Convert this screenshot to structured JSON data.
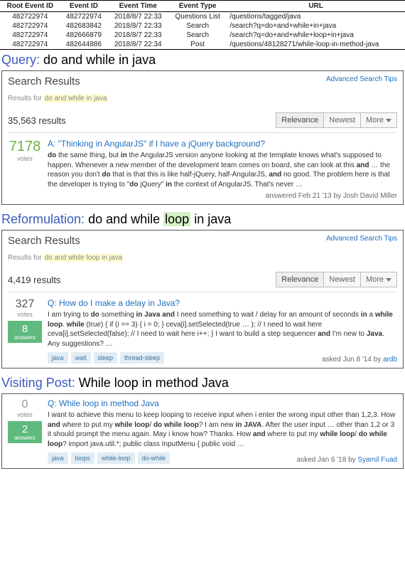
{
  "events": {
    "headers": [
      "Root Event ID",
      "Event ID",
      "Event Time",
      "Event Type",
      "URL"
    ],
    "rows": [
      {
        "root": "482722974",
        "id": "482722974",
        "time": "2018/8/7 22:33",
        "type": "Questions List",
        "url": "/questions/tagged/java"
      },
      {
        "root": "482722974",
        "id": "482683842",
        "time": "2018/8/7 22:33",
        "type": "Search",
        "url": "/search?q=do+and+while+in+java"
      },
      {
        "root": "482722974",
        "id": "482666879",
        "time": "2018/8/7 22:33",
        "type": "Search",
        "url": "/search?q=do+and+while+loop+in+java"
      },
      {
        "root": "482722974",
        "id": "482644886",
        "time": "2018/8/7 22:34",
        "type": "Post",
        "url": "/questions/48128271/while-loop-in-method-java"
      }
    ]
  },
  "sections": {
    "query": {
      "kind": "Query:",
      "text": "do and while in java"
    },
    "reformulation": {
      "kind": "Reformulation:",
      "prefix": "do and while ",
      "diff": "loop",
      "suffix": " in java"
    },
    "visiting": {
      "kind": "Visiting Post:",
      "text": "While loop in method Java"
    }
  },
  "panel1": {
    "title": "Search Results",
    "adv": "Advanced Search Tips",
    "results_for_prefix": "Results for ",
    "results_for_q": "do and while in java",
    "count": "35,563 results",
    "sort": {
      "relevance": "Relevance",
      "newest": "Newest",
      "more": "More"
    },
    "result": {
      "votes": "7178",
      "votes_label": "votes",
      "title": "A: \"Thinking in AngularJS\" if I have a jQuery background?",
      "excerpt_parts": [
        "do",
        " the same thing, but ",
        "in",
        " the AngularJS version anyone looking at the template knows what's supposed to happen. Whenever a new member of the development team comes on board, she can look at this ",
        "and",
        " … the reason you don't ",
        "do",
        " that is that this is like half-jQuery, half-AngularJS, ",
        "and",
        " no good. The problem here is that the developer is trying to \"",
        "do",
        " jQuery\" ",
        "in",
        " the context of AngularJS. That's never …"
      ],
      "meta_prefix": "answered Feb 21 '13 by ",
      "meta_author": "Josh David Miller"
    }
  },
  "panel2": {
    "title": "Search Results",
    "adv": "Advanced Search Tips",
    "results_for_prefix": "Results for ",
    "results_for_q": "do and while loop in java",
    "count": "4,419 results",
    "sort": {
      "relevance": "Relevance",
      "newest": "Newest",
      "more": "More"
    },
    "result": {
      "votes": "327",
      "votes_label": "votes",
      "answers": "8",
      "answers_label": "answers",
      "title": "Q: How do I make a delay in Java?",
      "excerpt_parts": [
        "I am trying to ",
        "do",
        " something ",
        "in Java and",
        " I need something to wait / delay for an amount of seconds ",
        "in",
        " a ",
        "while loop",
        ". ",
        "while",
        " (true) { if (i == 3) { i = 0; } ceva[i].setSelected(true … ); // I need to wait here ceva[i].setSelected(false); // I need to wait here i++; } I want to build a step sequencer ",
        "and",
        " I'm new to ",
        "Java",
        ". Any suggestions? …"
      ],
      "tags": [
        "java",
        "wait",
        "sleep",
        "thread-sleep"
      ],
      "meta_prefix": "asked Jun 8 '14 by ",
      "meta_author": "ardb"
    }
  },
  "panel3": {
    "result": {
      "votes": "0",
      "votes_label": "votes",
      "answers": "2",
      "answers_label": "answers",
      "title": "Q: While loop in method Java",
      "excerpt_parts": [
        "I want to achieve this menu to keep looping to receive input when i enter the wrong input other than 1,2,3. How ",
        "and",
        " where to put my ",
        "while loop",
        "/ ",
        "do while loop",
        "? I am new ",
        "in JAVA",
        ". After the user input … other than 1,2 or 3 it should prompt the menu again. May i know how? Thanks. How ",
        "and",
        " where to put my ",
        "while loop",
        "/ ",
        "do while loop",
        "? import java.util.*; public class InputMenu { public void …"
      ],
      "tags": [
        "java",
        "loops",
        "while-loop",
        "do-while"
      ],
      "meta_prefix": "asked Jan 6 '18 by ",
      "meta_author": "Syamil Fuad"
    }
  }
}
